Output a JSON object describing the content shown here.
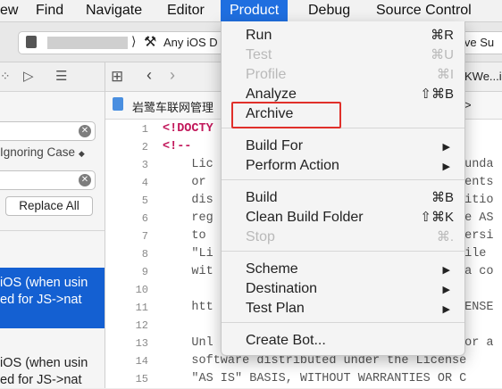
{
  "menubar": {
    "items": [
      "ew",
      "Find",
      "Navigate",
      "Editor",
      "Product",
      "Debug",
      "Source Control"
    ],
    "active": "Product"
  },
  "toolbar": {
    "scheme_text": "Any iOS D",
    "status_text": "ive Su"
  },
  "navigator": {
    "ignoring_case": "Ignoring Case",
    "replace_all": "Replace All",
    "results": [
      [
        "iOS (when usin",
        "ed for JS->nat"
      ],
      [
        "iOS (when usin",
        "ed for JS->nat"
      ]
    ]
  },
  "editor": {
    "breadcrumb": "岩鹭车联网管理",
    "tab_right": "KWe...i",
    "jump_right": ">",
    "line_numbers": [
      "1",
      "2",
      "3",
      "4",
      "5",
      "6",
      "7",
      "8",
      "9",
      "10",
      "11",
      "12",
      "13",
      "14",
      "15"
    ],
    "lines_left": [
      "<!DOCTY",
      "<!--",
      "    Lic",
      "    or ",
      "    dis",
      "    reg",
      "    to ",
      "    \"Li",
      "    wit",
      "",
      "    htt",
      "",
      "    Unl",
      "    software distributed under the License",
      "    \"AS IS\" BASIS, WITHOUT WARRANTIES OR C"
    ],
    "lines_right": [
      "",
      "",
      "ounda",
      "ments",
      "ditio",
      "he AS",
      "Versi",
      "file ",
      " a co",
      "",
      "CENSE",
      "",
      " or a",
      "",
      ""
    ]
  },
  "product_menu": {
    "items": [
      {
        "label": "Run",
        "shortcut": "⌘R",
        "enabled": true
      },
      {
        "label": "Test",
        "shortcut": "⌘U",
        "enabled": false
      },
      {
        "label": "Profile",
        "shortcut": "⌘I",
        "enabled": false
      },
      {
        "label": "Analyze",
        "shortcut": "⇧⌘B",
        "enabled": true
      },
      {
        "label": "Archive",
        "shortcut": "",
        "enabled": true
      },
      {
        "label": "Build For",
        "shortcut": "▶",
        "enabled": true
      },
      {
        "label": "Perform Action",
        "shortcut": "▶",
        "enabled": true
      },
      {
        "label": "Build",
        "shortcut": "⌘B",
        "enabled": true
      },
      {
        "label": "Clean Build Folder",
        "shortcut": "⇧⌘K",
        "enabled": true
      },
      {
        "label": "Stop",
        "shortcut": "⌘.",
        "enabled": false
      },
      {
        "label": "Scheme",
        "shortcut": "▶",
        "enabled": true
      },
      {
        "label": "Destination",
        "shortcut": "▶",
        "enabled": true
      },
      {
        "label": "Test Plan",
        "shortcut": "▶",
        "enabled": true
      },
      {
        "label": "Create Bot...",
        "shortcut": "",
        "enabled": true
      }
    ]
  },
  "colors": {
    "accent": "#1f6fe0",
    "highlight_box": "#e0302a"
  }
}
